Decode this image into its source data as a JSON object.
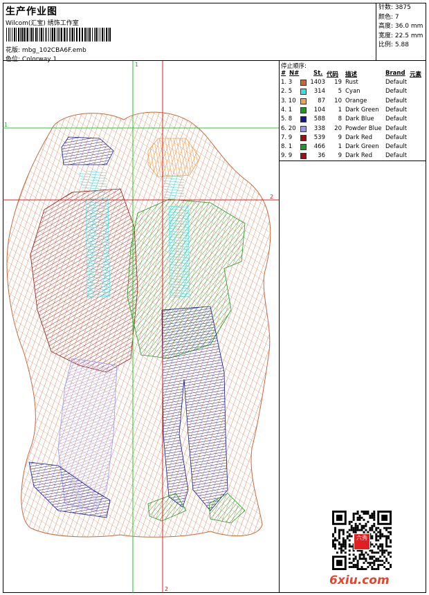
{
  "header": {
    "title": "生产作业图",
    "company": "Wilcom(汇宝) 绣饰工作室",
    "design_label": "花版:",
    "design_value": "mbg_102CBA6F.emb",
    "colorway_label": "色位:",
    "colorway_value": "Colorway 1"
  },
  "stats": [
    {
      "label": "针数:",
      "value": "3875"
    },
    {
      "label": "颜色:",
      "value": "7"
    },
    {
      "label": "高度:",
      "value": "36.0 mm"
    },
    {
      "label": "宽度:",
      "value": "22.5 mm"
    },
    {
      "label": "比例:",
      "value": "5.88"
    }
  ],
  "guides": {
    "v1": "1",
    "h1": "1",
    "h2": "2",
    "v2": "2"
  },
  "threads": {
    "caption": "停止顺序:",
    "headers": {
      "num": "#",
      "n": "N#",
      "st": "St.",
      "code": "代码",
      "desc": "描述",
      "brand": "Brand",
      "elem": "元素"
    },
    "rows": [
      {
        "idx": "1. 3",
        "st": "1403",
        "code": "19",
        "desc": "Rust",
        "brand": "Default",
        "color": "#c8693a"
      },
      {
        "idx": "2. 5",
        "st": "314",
        "code": "5",
        "desc": "Cyan",
        "brand": "Default",
        "color": "#2ee3e8"
      },
      {
        "idx": "3. 10",
        "st": "87",
        "code": "10",
        "desc": "Orange",
        "brand": "Default",
        "color": "#f5a04a"
      },
      {
        "idx": "4. 1",
        "st": "104",
        "code": "1",
        "desc": "Dark Green",
        "brand": "Default",
        "color": "#1f9a1f"
      },
      {
        "idx": "5. 8",
        "st": "588",
        "code": "8",
        "desc": "Dark Blue",
        "brand": "Default",
        "color": "#101890"
      },
      {
        "idx": "6. 20",
        "st": "338",
        "code": "20",
        "desc": "Powder Blue",
        "brand": "Default",
        "color": "#9a96ee"
      },
      {
        "idx": "7. 9",
        "st": "539",
        "code": "9",
        "desc": "Dark Red",
        "brand": "Default",
        "color": "#9a0f12"
      },
      {
        "idx": "8. 1",
        "st": "466",
        "code": "1",
        "desc": "Dark Green",
        "brand": "Default",
        "color": "#1f9a1f"
      },
      {
        "idx": "9. 9",
        "st": "36",
        "code": "9",
        "desc": "Dark Red",
        "brand": "Default",
        "color": "#9a0f12"
      }
    ]
  },
  "watermark": "6xiu.com",
  "qr_stamp_text": "六秀"
}
